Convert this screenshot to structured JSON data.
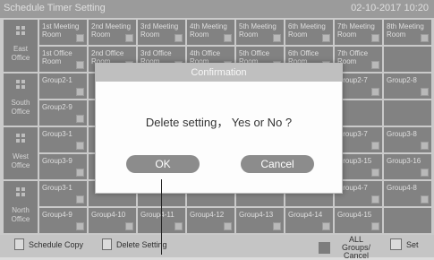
{
  "title": "Schedule Timer Setting",
  "datetime": "02-10-2017  10:20",
  "rows": [
    {
      "group": "East Office",
      "cells": [
        [
          "1st Meeting Room",
          "2nd Meeting Room",
          "3rd Meeting Room",
          "4th Meeting Room",
          "5th Meeting Room",
          "6th Meeting Room",
          "7th Meeting Room",
          "8th Meeting Room"
        ],
        [
          "1st Office Room",
          "2nd Office Room",
          "3rd Office Room",
          "4th Office Room",
          "5th Office Room",
          "6th Office Room",
          "7th Office Room",
          ""
        ]
      ]
    },
    {
      "group": "South Office",
      "cells": [
        [
          "Group2-1",
          "",
          "",
          "",
          "",
          "",
          "Group2-7",
          "Group2-8"
        ],
        [
          "Group2-9",
          "",
          "",
          "",
          "",
          "",
          "",
          ""
        ]
      ]
    },
    {
      "group": "West Office",
      "cells": [
        [
          "Group3-1",
          "",
          "",
          "",
          "",
          "",
          "Group3-7",
          "Group3-8"
        ],
        [
          "Group3-9",
          "",
          "",
          "",
          "",
          "",
          "Group3-15",
          "Group3-16"
        ]
      ]
    },
    {
      "group": "North Office",
      "cells": [
        [
          "Group3-1",
          "",
          "",
          "",
          "",
          "",
          "Group4-7",
          "Group4-8"
        ],
        [
          "Group4-9",
          "Group4-10",
          "Group4-11",
          "Group4-12",
          "Group4-13",
          "Group4-14",
          "Group4-15",
          ""
        ]
      ]
    }
  ],
  "bottom": {
    "schedule_copy": "Schedule Copy",
    "delete_setting": "Delete Setting",
    "all_groups": "ALL Groups/ Cancel",
    "set": "Set"
  },
  "dialog": {
    "title": "Confirmation",
    "message": "Delete setting， Yes or No ?",
    "ok": "OK",
    "cancel": "Cancel"
  }
}
